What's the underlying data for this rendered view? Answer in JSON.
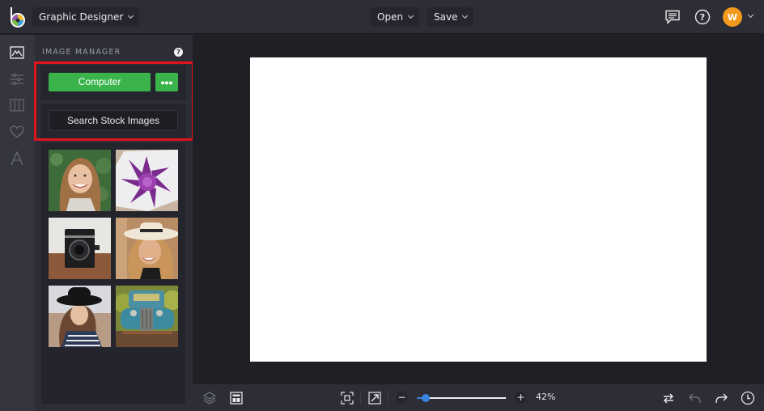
{
  "header": {
    "app_mode": "Graphic Designer",
    "open_label": "Open",
    "save_label": "Save",
    "avatar_initial": "W",
    "icons": [
      "logo-icon",
      "comments-icon",
      "help-icon",
      "chevron-down-icon"
    ]
  },
  "rail": {
    "items": [
      {
        "name": "image-manager",
        "icon": "image-icon",
        "active": true
      },
      {
        "name": "adjustments",
        "icon": "sliders-icon",
        "active": false
      },
      {
        "name": "frames",
        "icon": "columns-icon",
        "active": false
      },
      {
        "name": "graphics",
        "icon": "heart-icon",
        "active": false
      },
      {
        "name": "text",
        "icon": "text-icon",
        "active": false
      }
    ]
  },
  "panel": {
    "title": "IMAGE MANAGER",
    "help": "?",
    "computer_label": "Computer",
    "more_label": "•••",
    "stock_label": "Search Stock Images",
    "thumbnails": [
      {
        "subject": "smiling woman with long hair"
      },
      {
        "subject": "purple succulent flower"
      },
      {
        "subject": "vintage camera"
      },
      {
        "subject": "woman in white hat"
      },
      {
        "subject": "woman in black hat"
      },
      {
        "subject": "vintage blue truck"
      }
    ]
  },
  "bottombar": {
    "zoom_percent": 42,
    "zoom_label": "42%",
    "slider_value": 0.1,
    "zoom_out": "−",
    "zoom_in": "+"
  },
  "colors": {
    "accent_green": "#3ab44a",
    "highlight_red": "#e0141b",
    "avatar_orange": "#f39a1e",
    "slider_blue": "#3a84e0"
  }
}
